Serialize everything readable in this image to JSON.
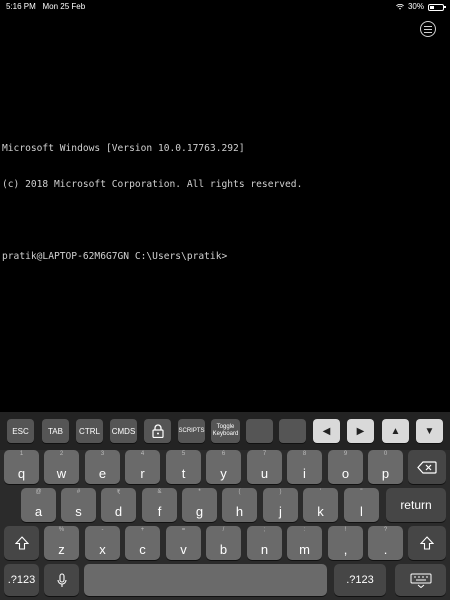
{
  "status_bar": {
    "time": "5:16 PM",
    "date": "Mon 25 Feb",
    "battery_text": "30%",
    "battery_level": 0.3
  },
  "terminal": {
    "lines": [
      "Microsoft Windows [Version 10.0.17763.292]",
      "(c) 2018 Microsoft Corporation. All rights reserved.",
      "",
      "pratik@LAPTOP-62M6G7GN C:\\Users\\pratik>"
    ]
  },
  "toolbar": {
    "esc": "ESC",
    "tab": "TAB",
    "ctrl": "CTRL",
    "cmds": "CMDS",
    "scripts": "SCRIPTS",
    "toggle_keyboard_1": "Toggle",
    "toggle_keyboard_2": "Keyboard",
    "left_arrow": "◀",
    "right_arrow": "▶",
    "up_arrow": "▲",
    "down_arrow": "▼"
  },
  "keyboard": {
    "row1": [
      {
        "hint": "1",
        "key": "q"
      },
      {
        "hint": "2",
        "key": "w"
      },
      {
        "hint": "3",
        "key": "e"
      },
      {
        "hint": "4",
        "key": "r"
      },
      {
        "hint": "5",
        "key": "t"
      },
      {
        "hint": "6",
        "key": "y"
      },
      {
        "hint": "7",
        "key": "u"
      },
      {
        "hint": "8",
        "key": "i"
      },
      {
        "hint": "9",
        "key": "o"
      },
      {
        "hint": "0",
        "key": "p"
      }
    ],
    "row2": [
      {
        "hint": "@",
        "key": "a"
      },
      {
        "hint": "#",
        "key": "s"
      },
      {
        "hint": "₹",
        "key": "d"
      },
      {
        "hint": "&",
        "key": "f"
      },
      {
        "hint": "*",
        "key": "g"
      },
      {
        "hint": "(",
        "key": "h"
      },
      {
        "hint": ")",
        "key": "j"
      },
      {
        "hint": "'",
        "key": "k"
      },
      {
        "hint": "\"",
        "key": "l"
      }
    ],
    "row3": [
      {
        "hint": "%",
        "key": "z"
      },
      {
        "hint": "-",
        "key": "x"
      },
      {
        "hint": "+",
        "key": "c"
      },
      {
        "hint": "=",
        "key": "v"
      },
      {
        "hint": "/",
        "key": "b"
      },
      {
        "hint": ";",
        "key": "n"
      },
      {
        "hint": ":",
        "key": "m"
      },
      {
        "hint": "!",
        "key": ","
      },
      {
        "hint": "?",
        "key": "."
      }
    ],
    "return_label": "return",
    "numbers_label": ".?123",
    "numbers_label_right": ".?123"
  }
}
